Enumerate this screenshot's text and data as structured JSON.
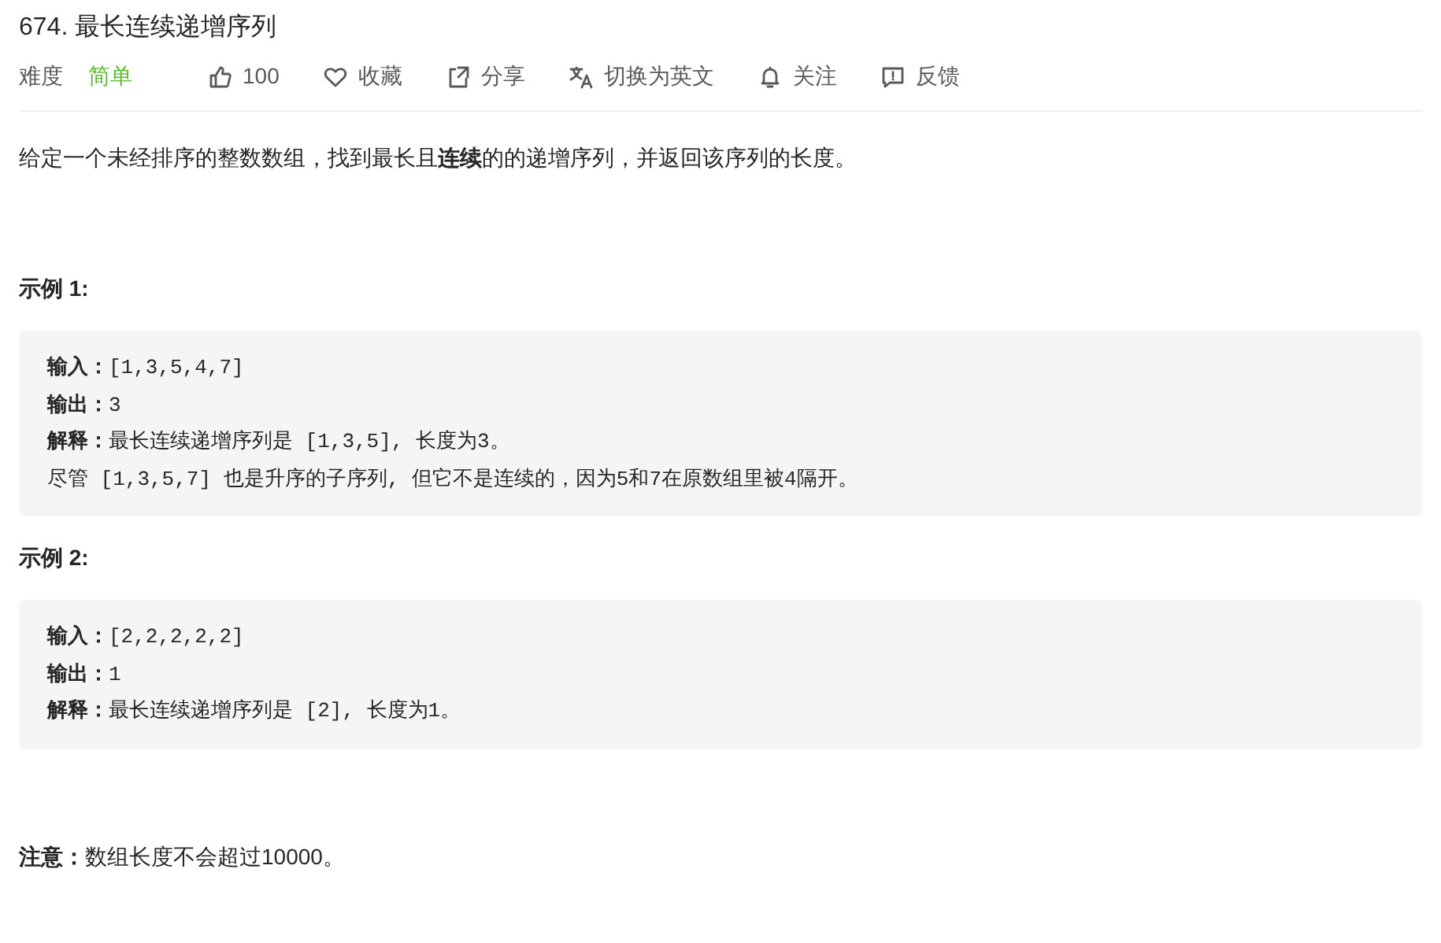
{
  "title": "674. 最长连续递增序列",
  "difficulty": {
    "label": "难度",
    "value": "简单"
  },
  "actions": [
    {
      "kind": "like",
      "label": "100"
    },
    {
      "kind": "favorite",
      "label": "收藏"
    },
    {
      "kind": "share",
      "label": "分享"
    },
    {
      "kind": "translate",
      "label": "切换为英文"
    },
    {
      "kind": "follow",
      "label": "关注"
    },
    {
      "kind": "feedback",
      "label": "反馈"
    }
  ],
  "description": "给定一个未经排序的整数数组，找到最长且**连续**的的递增序列，并返回该序列的长度。",
  "examples": [
    {
      "heading": "示例 1:",
      "lines": [
        "**输入：**[1,3,5,4,7]",
        "**输出：**3",
        "**解释：**最长连续递增序列是 [1,3,5], 长度为3。",
        "尽管 [1,3,5,7] 也是升序的子序列, 但它不是连续的，因为5和7在原数组里被4隔开。"
      ]
    },
    {
      "heading": "示例 2:",
      "lines": [
        "**输入：**[2,2,2,2,2]",
        "**输出：**1",
        "**解释：**最长连续递增序列是 [2], 长度为1。"
      ]
    }
  ],
  "note": "**注意：**数组长度不会超过10000。"
}
